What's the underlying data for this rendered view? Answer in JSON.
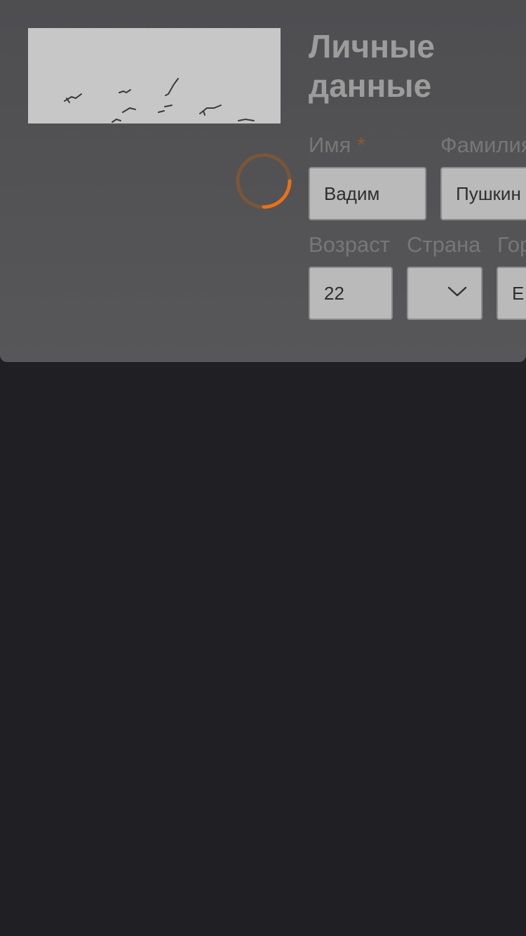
{
  "page": {
    "title": "Личные данные"
  },
  "form": {
    "first_name": {
      "label": "Имя",
      "required_mark": "*",
      "value": "Вадим"
    },
    "last_name": {
      "label": "Фамилия",
      "value": "Пушкин"
    },
    "age": {
      "label": "Возраст",
      "value": "22"
    },
    "country": {
      "label": "Страна",
      "value": ""
    },
    "city": {
      "label": "Город",
      "value": "Е"
    }
  },
  "loading": {
    "active": true
  },
  "colors": {
    "accent": "#e8711e",
    "background": "#201f24",
    "card": "#525254"
  },
  "icons": {
    "country_dropdown": "chevron-down-icon",
    "spinner": "loading-spinner-icon"
  }
}
